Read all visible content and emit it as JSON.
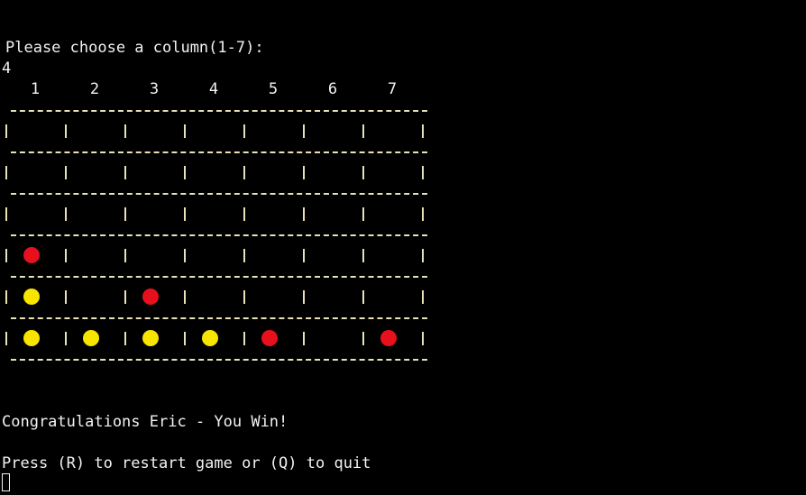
{
  "terminal": {
    "prompt": "Please choose a column(1-7):",
    "input_echo": "4",
    "column_labels": [
      "1",
      "2",
      "3",
      "4",
      "5",
      "6",
      "7"
    ],
    "board": [
      [
        "",
        "",
        "",
        "",
        "",
        "",
        ""
      ],
      [
        "",
        "",
        "",
        "",
        "",
        "",
        ""
      ],
      [
        "",
        "",
        "",
        "",
        "",
        "",
        ""
      ],
      [
        "red",
        "",
        "",
        "",
        "",
        "",
        ""
      ],
      [
        "yellow",
        "",
        "red",
        "",
        "",
        "",
        ""
      ],
      [
        "yellow",
        "yellow",
        "yellow",
        "yellow",
        "red",
        "",
        "red"
      ]
    ],
    "win_message": "Congratulations Eric - You Win!",
    "restart_message": "Press (R) to restart game or (Q) to quit"
  },
  "colors": {
    "background": "#000000",
    "text": "#f2f2f2",
    "grid": "#e8e2b8",
    "red_disc": "#e8101c",
    "yellow_disc": "#f7e500"
  }
}
